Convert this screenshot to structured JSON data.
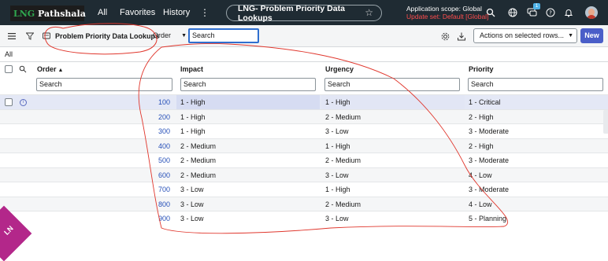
{
  "topbar": {
    "logo_prefix": "LNG",
    "logo_suffix": "Pathshala",
    "nav": [
      "All",
      "Favorites",
      "History"
    ],
    "more": "⋮",
    "record_title": "LNG- Problem Priority Data Lookups",
    "scope_label": "Application scope: Global",
    "update_set": "Update set: Default [Global]",
    "notification_count": "1"
  },
  "listbar": {
    "list_title": "Problem Priority Data Lookups",
    "search_field": "Order",
    "search_value": "Search",
    "actions_label": "Actions on selected rows...",
    "new_label": "New"
  },
  "breadcrumb": "All",
  "columns": {
    "order": "Order",
    "impact": "Impact",
    "urgency": "Urgency",
    "priority": "Priority"
  },
  "filters": {
    "order": "Search",
    "impact": "Search",
    "urgency": "Search",
    "priority": "Search"
  },
  "rows": [
    {
      "order": "100",
      "impact": "1 - High",
      "urgency": "1 - High",
      "priority": "1 - Critical"
    },
    {
      "order": "200",
      "impact": "1 - High",
      "urgency": "2 - Medium",
      "priority": "2 - High"
    },
    {
      "order": "300",
      "impact": "1 - High",
      "urgency": "3 - Low",
      "priority": "3 - Moderate"
    },
    {
      "order": "400",
      "impact": "2 - Medium",
      "urgency": "1 - High",
      "priority": "2 - High"
    },
    {
      "order": "500",
      "impact": "2 - Medium",
      "urgency": "2 - Medium",
      "priority": "3 - Moderate"
    },
    {
      "order": "600",
      "impact": "2 - Medium",
      "urgency": "3 - Low",
      "priority": "4 - Low"
    },
    {
      "order": "700",
      "impact": "3 - Low",
      "urgency": "1 - High",
      "priority": "3 - Moderate"
    },
    {
      "order": "800",
      "impact": "3 - Low",
      "urgency": "2 - Medium",
      "priority": "4 - Low"
    },
    {
      "order": "900",
      "impact": "3 - Low",
      "urgency": "3 - Low",
      "priority": "5 - Planning"
    }
  ],
  "colors": {
    "topbar_bg": "#1f2b33",
    "link_blue": "#2750b8",
    "new_button": "#4a5ec8",
    "annotation_red": "#e0362c",
    "update_set_red": "#ff4d4d"
  },
  "corner_badge": "LN",
  "icons": [
    "menu-icon",
    "filter-icon",
    "list-icon",
    "search-icon",
    "globe-icon",
    "chat-icon",
    "help-icon",
    "bell-icon",
    "gear-icon",
    "export-icon",
    "info-icon",
    "star-icon"
  ]
}
